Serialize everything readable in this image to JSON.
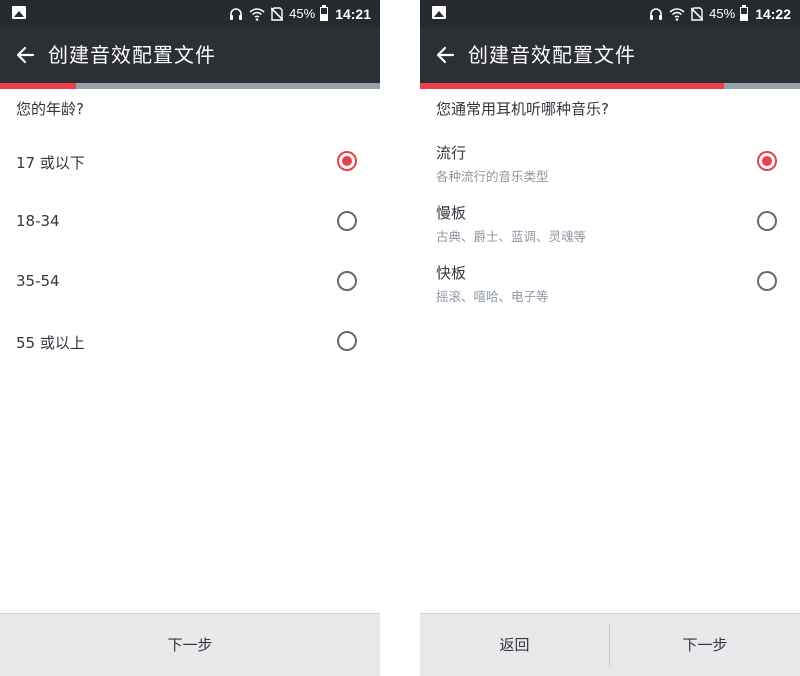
{
  "colors": {
    "accent": "#e8414a",
    "toolbar": "#2c2f34",
    "statusbar": "#26292e",
    "progress_track": "#9aa0ab",
    "bottom_bar": "#e8e9eb"
  },
  "left": {
    "status": {
      "battery": "45%",
      "time": "14:21"
    },
    "header": {
      "title": "创建音效配置文件"
    },
    "progress": 0.2,
    "question": "您的年龄?",
    "options": [
      {
        "label": "17 或以下",
        "selected": true
      },
      {
        "label": "18-34",
        "selected": false
      },
      {
        "label": "35-54",
        "selected": false
      },
      {
        "label": "55 或以上",
        "selected": false
      }
    ],
    "footer": {
      "next_label": "下一步"
    }
  },
  "right": {
    "status": {
      "battery": "45%",
      "time": "14:22"
    },
    "header": {
      "title": "创建音效配置文件"
    },
    "progress": 0.8,
    "question": "您通常用耳机听哪种音乐?",
    "options": [
      {
        "title": "流行",
        "subtitle": "各种流行的音乐类型",
        "selected": true
      },
      {
        "title": "慢板",
        "subtitle": "古典、爵士、蓝调、灵魂等",
        "selected": false
      },
      {
        "title": "快板",
        "subtitle": "摇滚、嘻哈、电子等",
        "selected": false
      }
    ],
    "footer": {
      "back_label": "返回",
      "next_label": "下一步"
    }
  }
}
